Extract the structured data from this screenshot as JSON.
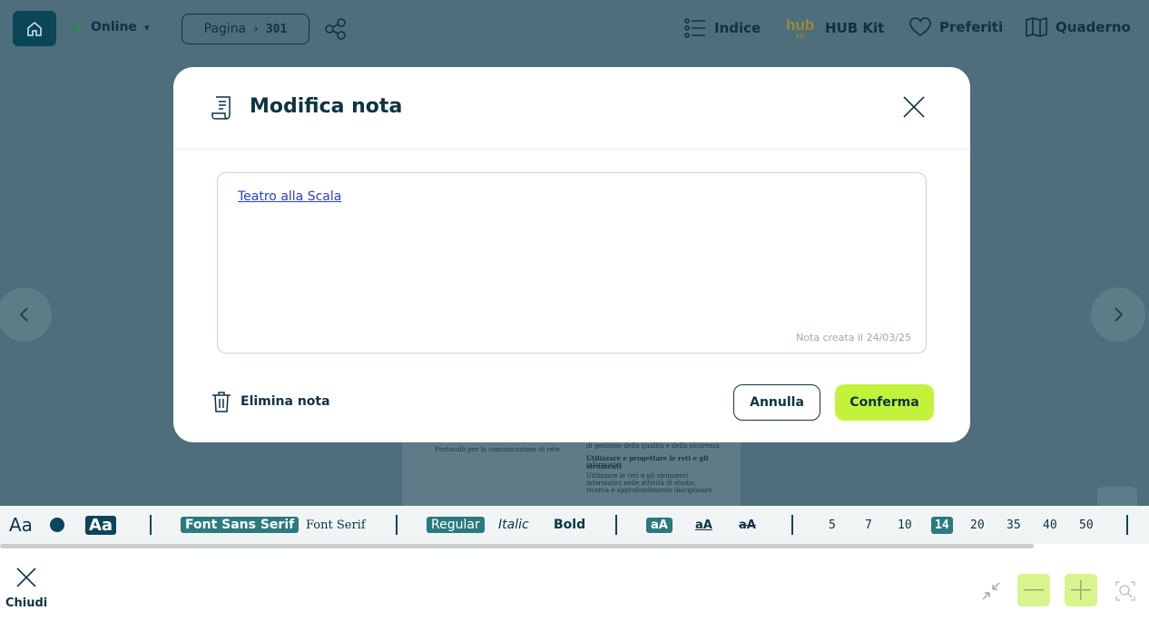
{
  "header": {
    "status_label": "Online",
    "page_label": "Pagina",
    "page_number": "301",
    "nav": {
      "indice": "Indice",
      "hub_kit": "HUB Kit",
      "preferiti": "Preferiti",
      "quaderno": "Quaderno"
    }
  },
  "book_page": {
    "left_item": "Protocolli per la comunicazione di rete",
    "right_lines": [
      "di gestione della qualità e della sicurezza",
      "Utilizzare e progettare le reti e gli strumenti",
      "informatici",
      "Utilizzare le reti e gli strumenti",
      "informatici nelle attività di studio,",
      "ricerca e approfondimento disciplinare"
    ]
  },
  "modal": {
    "title": "Modifica nota",
    "note_text": "Teatro alla Scala",
    "note_date": "Nota creata il 24/03/25",
    "delete_label": "Elimina nota",
    "cancel_label": "Annulla",
    "confirm_label": "Conferma"
  },
  "toolbar": {
    "font_size_icon": "Aa",
    "contrast_icon": "Aa",
    "font_sans": "Font Sans Serif",
    "font_serif": "Font Serif",
    "weight_regular": "Regular",
    "weight_italic": "Italic",
    "weight_bold": "Bold",
    "case_normal": "aA",
    "case_underline": "aA",
    "case_strike": "aA",
    "sizes": [
      "5",
      "7",
      "10",
      "14",
      "20",
      "35",
      "40",
      "50"
    ],
    "selected_size": "14"
  },
  "bottom": {
    "close_label": "Chiudi"
  },
  "colors": {
    "primary_dark": "#0b4558",
    "accent_green": "#c3f23a",
    "chip_teal": "#2a7a80",
    "overlay": "#4d6e7a"
  }
}
